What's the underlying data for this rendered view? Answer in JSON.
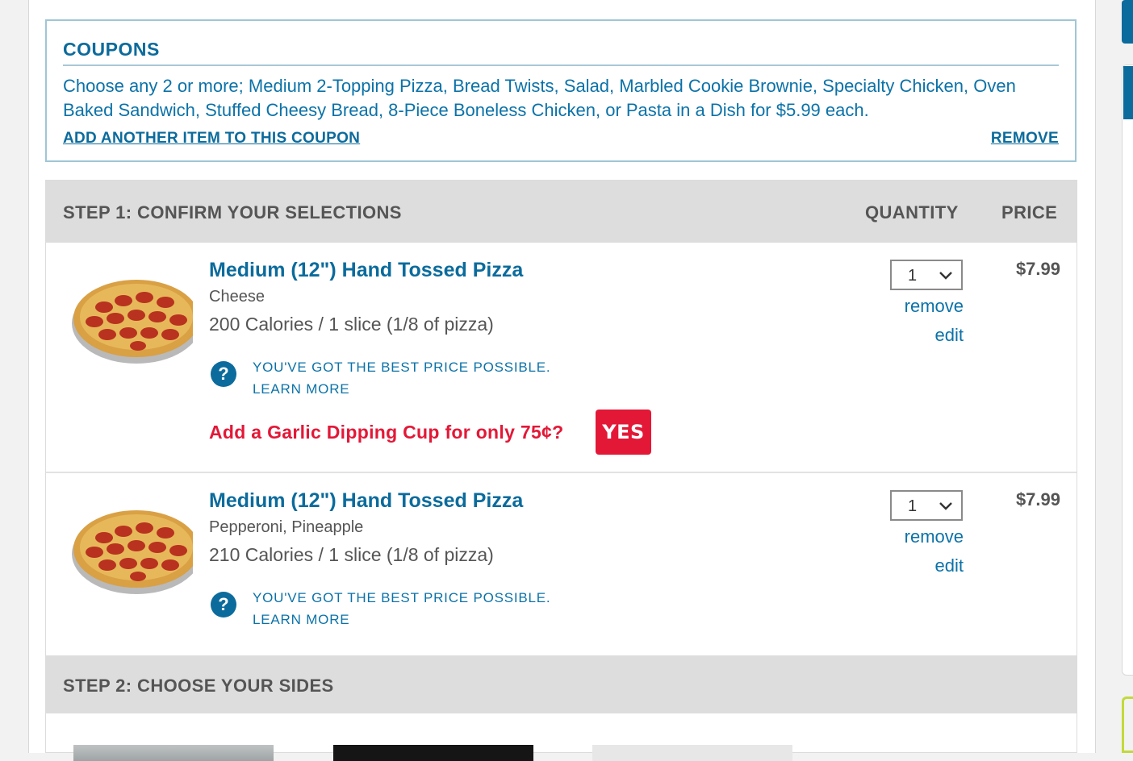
{
  "coupons": {
    "title": "COUPONS",
    "description": "Choose any 2 or more; Medium 2-Topping Pizza, Bread Twists, Salad, Marbled Cookie Brownie, Specialty Chicken, Oven Baked Sandwich, Stuffed Cheesy Bread, 8-Piece Boneless Chicken, or Pasta in a Dish for $5.99 each.",
    "add_link": "ADD ANOTHER ITEM TO THIS COUPON",
    "remove_link": "REMOVE"
  },
  "step1": {
    "title": "STEP 1: CONFIRM YOUR SELECTIONS",
    "quantity_header": "QUANTITY",
    "price_header": "PRICE"
  },
  "items": [
    {
      "name": "Medium (12\") Hand Tossed Pizza",
      "toppings": "Cheese",
      "calories": "200 Calories / 1 slice (1/8 of pizza)",
      "best_price_line1": "YOU'VE GOT THE BEST PRICE POSSIBLE.",
      "best_price_line2": "LEARN MORE",
      "help_icon": "?",
      "upsell": "Add a Garlic Dipping Cup for only 75¢?",
      "upsell_button": "YES",
      "quantity": "1",
      "remove": "remove",
      "edit": "edit",
      "price": "$7.99"
    },
    {
      "name": "Medium (12\") Hand Tossed Pizza",
      "toppings": "Pepperoni, Pineapple",
      "calories": "210 Calories / 1 slice (1/8 of pizza)",
      "best_price_line1": "YOU'VE GOT THE BEST PRICE POSSIBLE.",
      "best_price_line2": "LEARN MORE",
      "help_icon": "?",
      "quantity": "1",
      "remove": "remove",
      "edit": "edit",
      "price": "$7.99"
    }
  ],
  "step2": {
    "title": "STEP 2: CHOOSE YOUR SIDES"
  },
  "colors": {
    "brand_blue": "#0b6b9c",
    "accent_red": "#e31837",
    "header_gray": "#dddddd",
    "green_accent": "#c3d93a"
  }
}
